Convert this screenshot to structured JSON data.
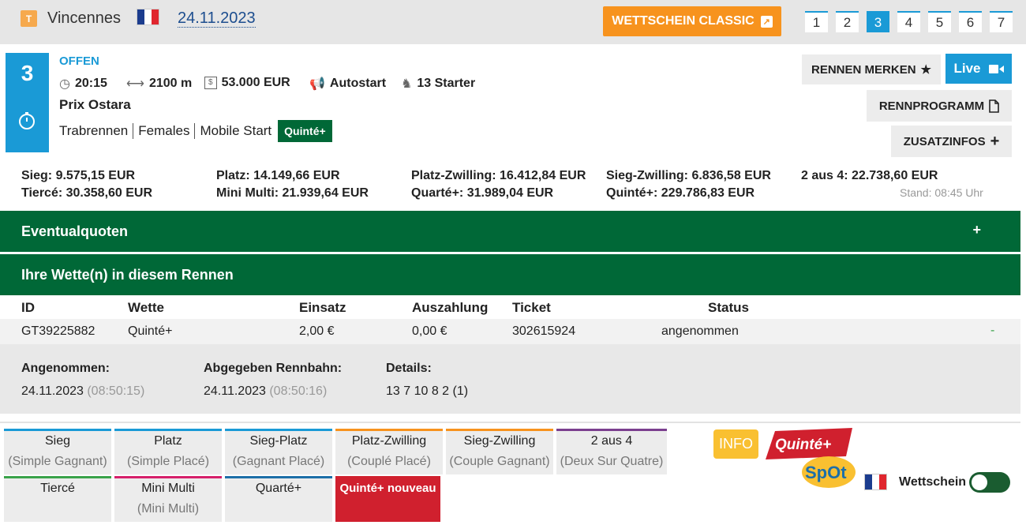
{
  "header": {
    "badge": "T",
    "venue": "Vincennes",
    "date": "24.11.2023",
    "wettschein_label": "WETTSCHEIN CLASSIC",
    "race_tabs": [
      "1",
      "2",
      "3",
      "4",
      "5",
      "6",
      "7"
    ],
    "active_tab": "3"
  },
  "race": {
    "number": "3",
    "status": "OFFEN",
    "time": "20:15",
    "distance": "2100 m",
    "prize": "53.000 EUR",
    "start_type": "Autostart",
    "starters": "13 Starter",
    "name": "Prix Ostara",
    "tags": [
      "Trabrennen",
      "Females",
      "Mobile Start"
    ],
    "bet_tag": "Quinté+"
  },
  "actions": {
    "merken": "RENNEN MERKEN",
    "live": "Live",
    "rennprogramm": "RENNPROGRAMM",
    "zusatzinfos": "ZUSATZINFOS"
  },
  "odds": {
    "row1": [
      "Sieg: 9.575,15 EUR",
      "Platz: 14.149,66 EUR",
      "Platz-Zwilling: 16.412,84 EUR",
      "Sieg-Zwilling: 6.836,58 EUR",
      "2 aus 4: 22.738,60 EUR"
    ],
    "row2": [
      "Tiercé: 30.358,60 EUR",
      "Mini Multi: 21.939,64 EUR",
      "Quarté+: 31.989,04 EUR",
      "Quinté+: 229.786,83 EUR"
    ],
    "stand": "Stand: 08:45 Uhr"
  },
  "sections": {
    "eventual": "Eventualquoten",
    "eventual_toggle": "+",
    "bets_title": "Ihre Wette(n) in diesem Rennen"
  },
  "bets_table": {
    "headers": [
      "ID",
      "Wette",
      "Einsatz",
      "Auszahlung",
      "Ticket",
      "Status"
    ],
    "rows": [
      {
        "id": "GT39225882",
        "wette": "Quinté+",
        "einsatz": "2,00 €",
        "auszahlung": "0,00 €",
        "ticket": "302615924",
        "status": "angenommen",
        "extra": "-"
      }
    ]
  },
  "details": {
    "angenommen_label": "Angenommen:",
    "angenommen_date": "24.11.2023",
    "angenommen_time": "(08:50:15)",
    "abgegeben_label": "Abgegeben Rennbahn:",
    "abgegeben_date": "24.11.2023",
    "abgegeben_time": "(08:50:16)",
    "details_label": "Details:",
    "details_value": "13 7 10 8 2 (1)"
  },
  "bet_types": [
    {
      "label": "Sieg",
      "sub": "(Simple Gagnant)",
      "color": "#1a9ad6"
    },
    {
      "label": "Platz",
      "sub": "(Simple Placé)",
      "color": "#1a9ad6"
    },
    {
      "label": "Sieg-Platz",
      "sub": "(Gagnant Placé)",
      "color": "#1a9ad6"
    },
    {
      "label": "Platz-Zwilling",
      "sub": "(Couplé Placé)",
      "color": "#f7931e"
    },
    {
      "label": "Sieg-Zwilling",
      "sub": "(Couple Gagnant)",
      "color": "#f7931e"
    },
    {
      "label": "2 aus 4",
      "sub": "(Deux Sur Quatre)",
      "color": "#7b3f8f"
    },
    {
      "label": "Tiercé",
      "sub": "",
      "color": "#3aa34a"
    },
    {
      "label": "Mini Multi",
      "sub": "(Mini Multi)",
      "color": "#d6206b"
    },
    {
      "label": "Quarté+",
      "sub": "",
      "color": "#1d6fa8"
    },
    {
      "label": "Quinté+ nouveau",
      "sub": "",
      "color": "#d0202e"
    }
  ],
  "footer": {
    "info": "INFO",
    "logo_text": "Quinté+ SpOt",
    "wettschein": "Wettschein"
  },
  "colors": {
    "accent": "#1a9ad6",
    "green": "#006837",
    "orange": "#f7931e"
  }
}
